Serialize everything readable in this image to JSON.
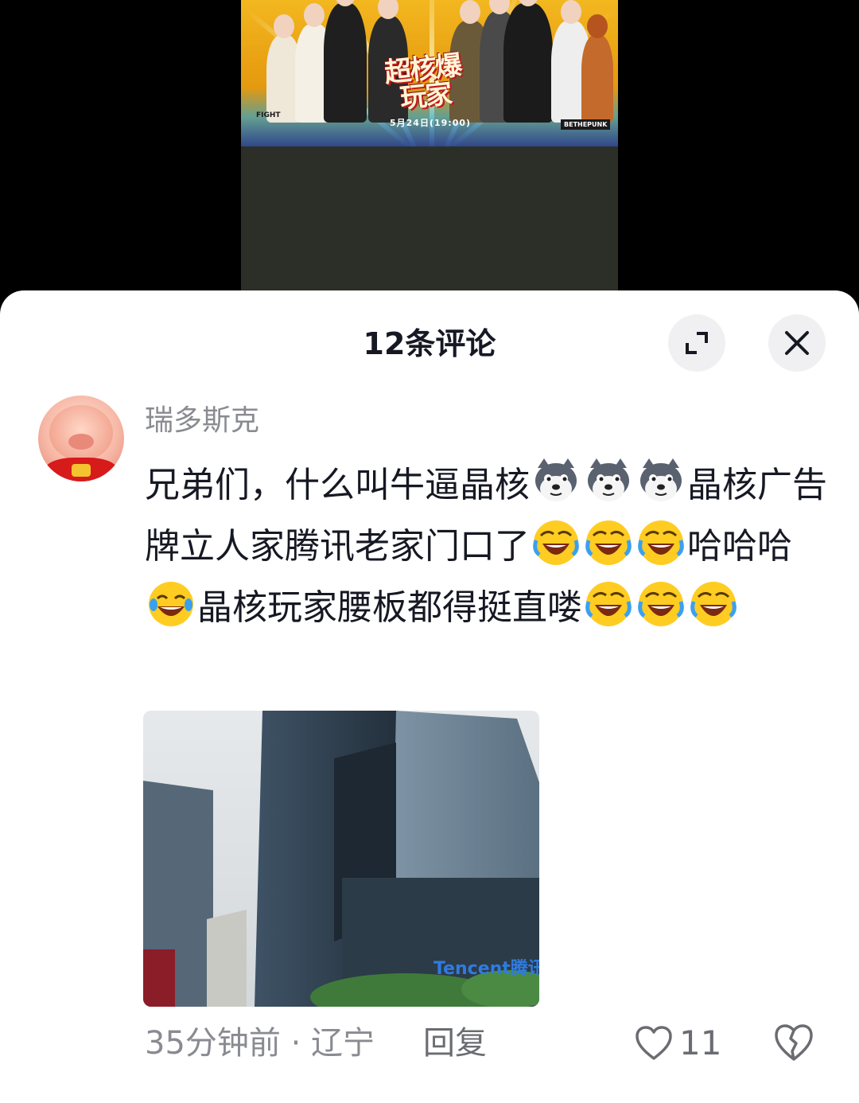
{
  "video": {
    "poster_title": "超核爆玩家",
    "poster_date": "5月24日(19:00)",
    "poster_left_logo": "FIGHT",
    "poster_right_logo": "BETHEPUNK"
  },
  "sheet": {
    "title": "12条评论"
  },
  "comment": {
    "username": "瑞多斯克",
    "text_part1": "兄弟们，什么叫牛逼晶核",
    "text_part2": "晶核广告牌立人家腾讯老家门口了",
    "text_part3": "哈哈哈",
    "text_part4": "晶核玩家腰板都得挺直喽",
    "image_caption": "Tencent腾讯",
    "time_location": "35分钟前 · 辽宁",
    "reply_label": "回复",
    "like_count": "11"
  },
  "colors": {
    "text_primary": "#161823",
    "text_secondary": "#8a8b91",
    "sheet_bg": "#ffffff",
    "button_bg": "#f0f0f2"
  }
}
